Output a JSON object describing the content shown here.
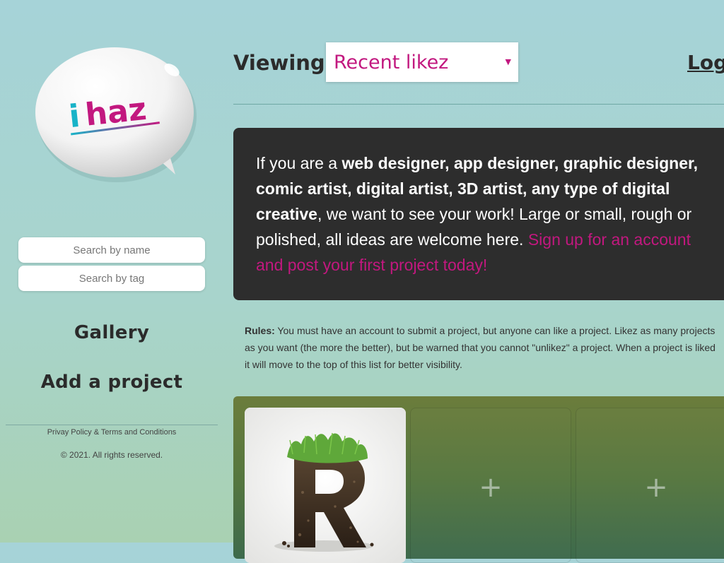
{
  "logo": {
    "text": "i haz"
  },
  "sidebar": {
    "search_name_placeholder": "Search by name",
    "search_tag_placeholder": "Search by tag",
    "nav": {
      "gallery": "Gallery",
      "add_project": "Add a project"
    },
    "footer": {
      "privacy": "Privay Policy",
      "and": "&",
      "terms": "Terms and Conditions",
      "copyright": "© 2021. All rights reserved."
    }
  },
  "header": {
    "viewing_label": "Viewing:",
    "viewing_selected": "Recent likez",
    "login": "Login"
  },
  "intro": {
    "p1": "If you are a ",
    "bold": "web designer, app designer, graphic designer, comic artist, digital artist, 3D artist, any type of digital creative",
    "p2": ", we want to see your work! Large or small, rough or polished, all ideas are welcome here. ",
    "link": "Sign up for an account and post your first project today!"
  },
  "rules": {
    "label": "Rules:",
    "text": " You must have an account to submit a project, but anyone can like a project. Likez as many projects as you want (the more the better), but be warned that you cannot \"unlikez\" a project. When a project is liked it will move to the top of this list for better visibility."
  },
  "gallery": {
    "add_glyph": "+"
  },
  "colors": {
    "accent": "#c2187f",
    "dark_box": "#2d2d2d",
    "logo_teal": "#18b3c8"
  }
}
